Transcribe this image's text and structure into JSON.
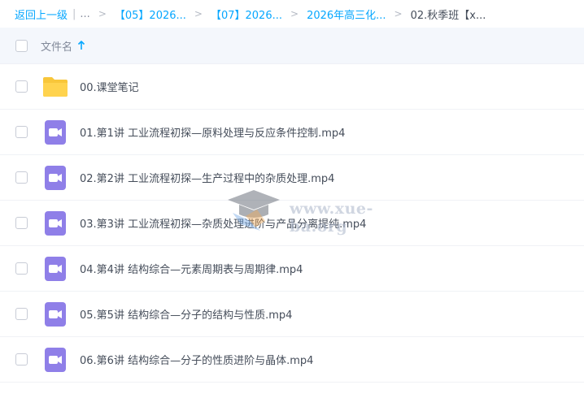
{
  "breadcrumb": {
    "back": "返回上一级",
    "pipe": "|",
    "ellipsis": "...",
    "sep": ">",
    "items": [
      "【05】2026...",
      "【07】2026...",
      "2026年高三化..."
    ],
    "current": "02.秋季班【x..."
  },
  "header": {
    "column_label": "文件名",
    "sort_icon": "arrow-up-icon"
  },
  "files": [
    {
      "name": "00.课堂笔记",
      "icon": "folder-icon"
    },
    {
      "name": "01.第1讲 工业流程初探—原料处理与反应条件控制.mp4",
      "icon": "video-icon"
    },
    {
      "name": "02.第2讲 工业流程初探—生产过程中的杂质处理.mp4",
      "icon": "video-icon"
    },
    {
      "name": "03.第3讲 工业流程初探—杂质处理进阶与产品分离提纯.mp4",
      "icon": "video-icon"
    },
    {
      "name": "04.第4讲 结构综合—元素周期表与周期律.mp4",
      "icon": "video-icon"
    },
    {
      "name": "05.第5讲 结构综合—分子的结构与性质.mp4",
      "icon": "video-icon"
    },
    {
      "name": "06.第6讲 结构综合—分子的性质进阶与晶体.mp4",
      "icon": "video-icon"
    }
  ],
  "watermark": "www.xue-ba.org",
  "colors": {
    "link": "#06a7ff",
    "folder": "#ffd34e",
    "video": "#8f7fe8",
    "header_bg": "#f4f7fc"
  }
}
